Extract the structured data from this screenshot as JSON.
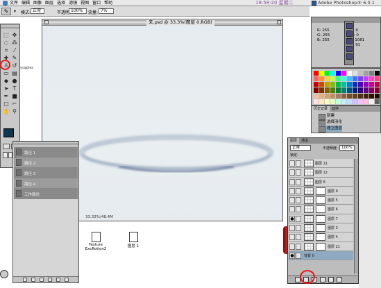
{
  "menubar": {
    "menus": [
      "文件",
      "编辑",
      "图像",
      "图层",
      "选择",
      "滤镜",
      "视图",
      "窗口",
      "帮助"
    ],
    "clock": "18:58:20 星期二",
    "app": "Adobe Photoshop® 6.0.1"
  },
  "options": {
    "mode_label": "模式:",
    "mode_value": "正常",
    "opacity_label": "不透明:",
    "opacity_value": "100%",
    "flow_label": "流量:",
    "flow_value": "7%"
  },
  "document": {
    "title": "未.psd @ 33.3%(图层 0,RGB)",
    "status": "33.33%/48.4M"
  },
  "comps": {
    "items": [
      "路径 1",
      "路径 2",
      "路径 3",
      "路径 4",
      "工作路径"
    ]
  },
  "desktop": {
    "files": [
      "Texture ExcRotion2",
      "图层 1"
    ],
    "side_label": "ycaples"
  },
  "info": {
    "r": "R: 255",
    "g": "G: 255",
    "b": "B: 255",
    "c": "C: 0",
    "m": "M: 0",
    "y": "Y: 1081",
    "k": "K: 91"
  },
  "history": {
    "tabs": [
      "历史记录",
      "动作"
    ],
    "items": [
      "新建",
      "选择羽化",
      "建立图层"
    ]
  },
  "layers": {
    "tabs": [
      "图层",
      "通道"
    ],
    "blend": "正常",
    "opacity_label": "不透明度:",
    "opacity_value": "100%",
    "lock_label": "锁定:",
    "rows": [
      "图层 11",
      "图层 12",
      "图层 8",
      "图层 9",
      "图层 5",
      "图层 6",
      "图层 7",
      "图层 3",
      "图层 4",
      "图层 21",
      "背景 0"
    ]
  },
  "colors": {
    "foreground": "#10354f",
    "accent_red": "#e21a1a",
    "selected_row": "#8ea9c0"
  }
}
